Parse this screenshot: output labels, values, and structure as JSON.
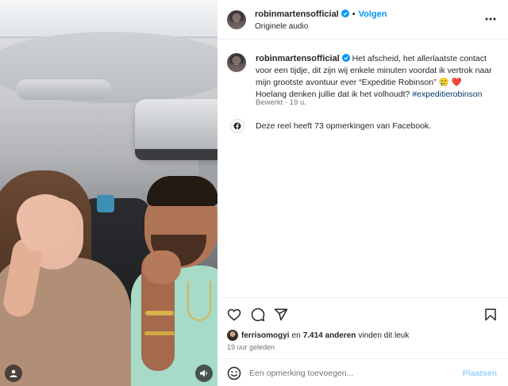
{
  "post": {
    "username": "robinmartensofficial",
    "follow_label": "Volgen",
    "audio_label": "Originele audio",
    "more_icon": "more-options-icon",
    "caption_text": "Het afscheid, het allerlaatste contact voor een tijdje, dit zijn wij enkele minuten voordat ik vertrok naar mijn grootste avontuur ever “Expeditie Robinson” 🥲 ❤️ Hoelang denken jullie dat ik het volhoudt?",
    "hashtag": "#expeditierobinson",
    "edited_label": "Bewerkt",
    "time_short": "19 u.",
    "facebook_note": "Deze reel heeft 73 opmerkingen van Facebook."
  },
  "likes": {
    "liker": "ferrisomogyi",
    "and_label": "en",
    "count": "7.414 anderen",
    "suffix": "vinden dit leuk"
  },
  "timestamp": "19 uur geleden",
  "comment": {
    "placeholder": "Een opmerking toevoegen...",
    "post_label": "Plaatsen"
  },
  "colors": {
    "accent": "#0095f6",
    "text": "#262626",
    "muted": "#737373",
    "hashtag": "#00376b",
    "post_disabled": "#9bd0fb"
  },
  "icons": [
    "like-icon",
    "comment-icon",
    "share-icon",
    "save-icon",
    "emoji-icon",
    "facebook-icon",
    "user-tag-icon",
    "sound-icon",
    "verified-icon"
  ]
}
